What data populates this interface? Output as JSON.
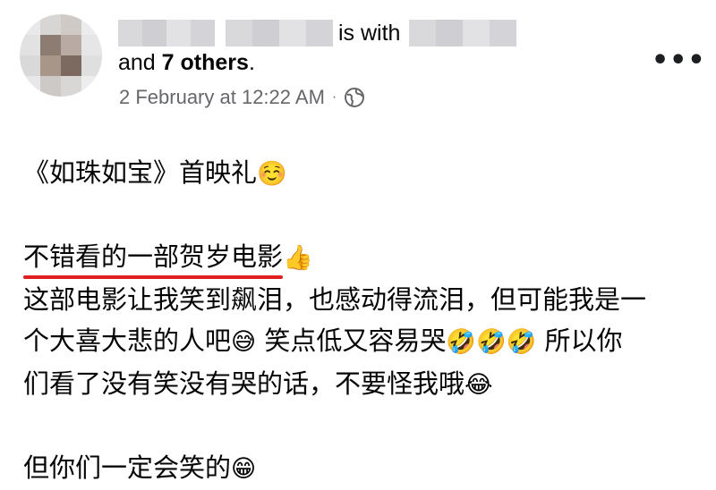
{
  "header": {
    "with_text": "is with",
    "and_text": "and",
    "others": "7 others",
    "period": ".",
    "timestamp": "2 February at 12:22 AM",
    "separator": "·",
    "audience_icon": "globe-icon",
    "more_label": "•••"
  },
  "post": {
    "line1": "《如珠如宝》首映礼",
    "line1_emoji": "☺️",
    "line2_underlined": "不错看的一部贺岁电影",
    "line2_emoji": "👍",
    "line3": "这部电影让我笑到飙泪，也感动得流泪，但可能我是一",
    "line4a": "个大喜大悲的人吧",
    "line4_emoji1": "😅",
    "line4b": " 笑点低又容易哭",
    "line4_emoji2": "🤣🤣🤣",
    "line4c": " 所以你",
    "line5": "们看了没有笑没有哭的话，不要怪我哦",
    "line5_emoji": "😂",
    "line6": "但你们一定会笑的",
    "line6_emoji": "😁"
  },
  "colors": {
    "underline": "#e02020",
    "meta": "#65676b"
  }
}
